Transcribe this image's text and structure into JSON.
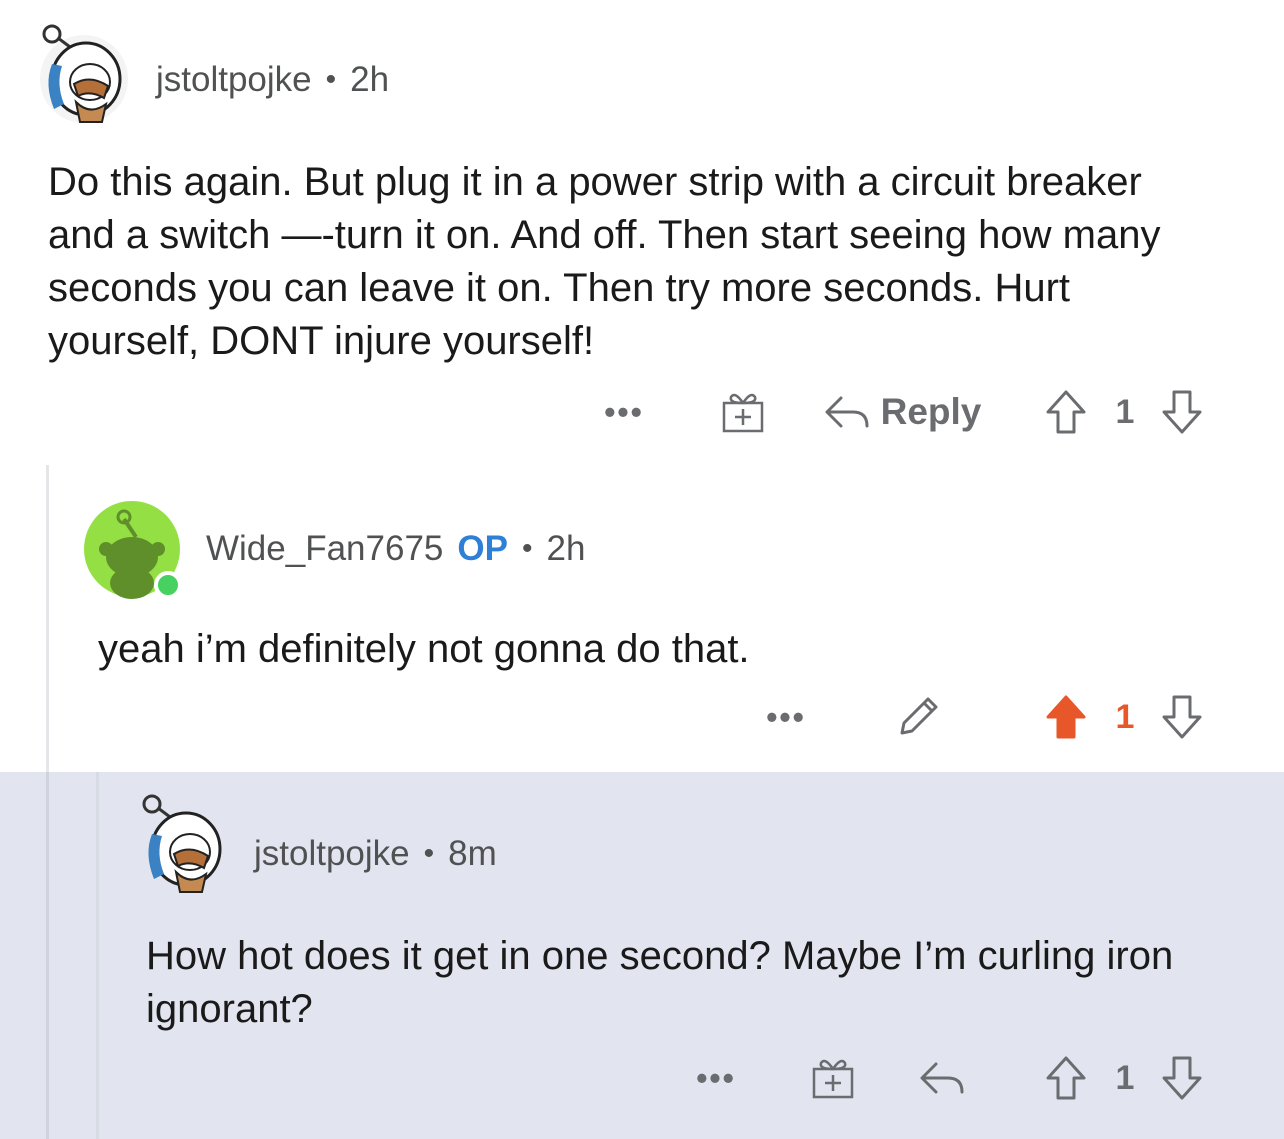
{
  "comments": [
    {
      "username": "jstoltpojke",
      "time": "2h",
      "text": "Do this again. But plug it in a power strip with a circuit breaker and a switch —-turn it on. And off. Then start seeing how many seconds you can leave it on. Then try more seconds. Hurt yourself, DONT injure yourself!",
      "more": "•••",
      "reply_label": "Reply",
      "score": "1",
      "upvoted": false
    },
    {
      "username": "Wide_Fan7675",
      "op_badge": "OP",
      "time": "2h",
      "text": "yeah i’m definitely not gonna do that.",
      "more": "•••",
      "score": "1",
      "upvoted": true
    },
    {
      "username": "jstoltpojke",
      "time": "8m",
      "text": "How hot does it get in one second?  Maybe I’m curling iron ignorant?",
      "more": "•••",
      "score": "1",
      "upvoted": false
    }
  ],
  "separator": "•",
  "colors": {
    "upvote_active": "#e8572a",
    "op_badge": "#2e7fd6",
    "highlight_bg": "#e2e5ef",
    "online_dot": "#46d160",
    "default_avatar_bg": "#94e044"
  },
  "icons": {
    "gift": "gift-icon",
    "reply": "reply-arrow-icon",
    "upvote": "upvote-arrow-icon",
    "downvote": "downvote-arrow-icon",
    "edit": "pencil-icon"
  }
}
